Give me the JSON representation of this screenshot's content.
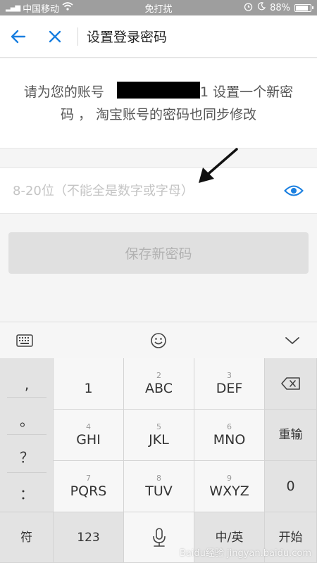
{
  "status_bar": {
    "carrier": "中国移动",
    "center": "免打扰",
    "battery": "88%"
  },
  "header": {
    "title": "设置登录密码"
  },
  "info": {
    "line1_prefix": "请为您的账号",
    "line1_suffix": "1 设置一个新密",
    "line2": "码 ， 淘宝账号的密码也同步修改"
  },
  "password": {
    "value": "",
    "placeholder": "8-20位（不能全是数字或字母）"
  },
  "save_button": {
    "label": "保存新密码"
  },
  "keyboard": {
    "punct": [
      ",",
      "。",
      "？",
      "："
    ],
    "keys": [
      {
        "digit": "",
        "label": "1"
      },
      {
        "digit": "2",
        "label": "ABC"
      },
      {
        "digit": "3",
        "label": "DEF"
      },
      {
        "digit": "4",
        "label": "GHI"
      },
      {
        "digit": "5",
        "label": "JKL"
      },
      {
        "digit": "6",
        "label": "MNO"
      },
      {
        "digit": "7",
        "label": "PQRS"
      },
      {
        "digit": "8",
        "label": "TUV"
      },
      {
        "digit": "9",
        "label": "WXYZ"
      }
    ],
    "reenter": "重输",
    "zero": "0",
    "symbol": "符",
    "num_mode": "123",
    "lang": "中/英",
    "start": "开始"
  },
  "watermark": "Baidu经验 jingyan.baidu.com",
  "colors": {
    "accent": "#1a7fe0",
    "statusbar": "#9e9e9e",
    "button_disabled": "#e0e0e0"
  }
}
